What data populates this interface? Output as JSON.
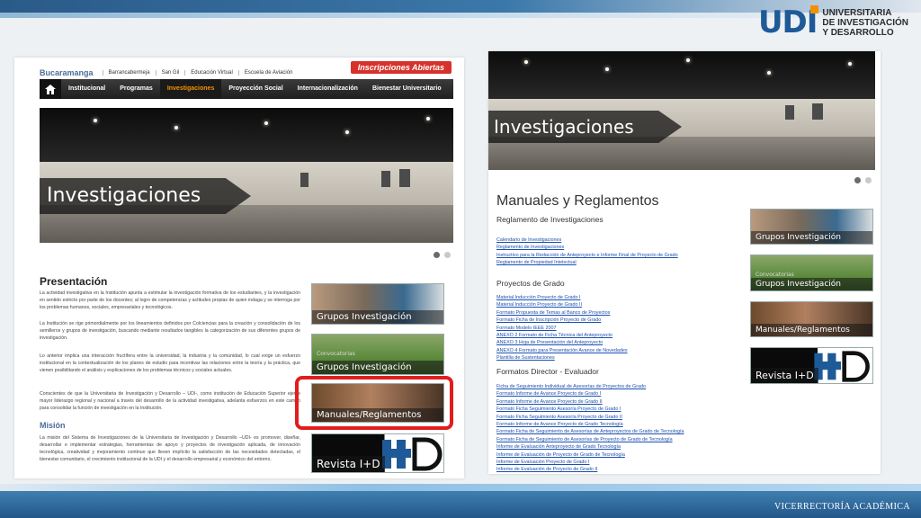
{
  "slide": {
    "logo": {
      "mark": "UDI",
      "line1": "UNIVERSITARIA",
      "line2": "DE INVESTIGACIÓN",
      "line3": "Y DESARROLLO"
    },
    "footer": "VICERRECTORÍA ACADÉMICA",
    "colors": {
      "brand_blue": "#1f5a98",
      "accent_orange": "#f29100",
      "highlight_red": "#e21d1d"
    }
  },
  "left": {
    "campus_main": "Bucaramanga",
    "campus_links": [
      "Barrancabermeja",
      "San Gil",
      "Educación Virtual",
      "Escuela de Aviación"
    ],
    "inscripciones": "Inscripciones Abiertas",
    "nav": {
      "home_icon": "home-icon",
      "items": [
        "Institucional",
        "Programas",
        "Investigaciones",
        "Proyección Social",
        "Internacionalización",
        "Bienestar Universitario"
      ],
      "active": "Investigaciones"
    },
    "banner_label": "Investigaciones",
    "presentacion_title": "Presentación",
    "paragraphs": [
      "La actividad investigativa en la Institución apunta a estimular la investigación formativa de los estudiantes, y la investigación en sentido estricto por parte de los docentes; al logro de competencias y actitudes propias de quien indaga y se interroga por los problemas humanos, sociales, empresariales y tecnológicos.",
      "La Institución se rige primordialmente por los lineamientos definidos por Colciencias para la creación y consolidación de los semilleros y grupos de investigación, buscando mediante resultados tangibles la categorización de sus diferentes grupos de investigación.",
      "Lo anterior implica una interacción fructífera entre la universidad, la industria y la comunidad, lo cual exige un esfuerzo institucional en la contextualización de los planes de estudio para incentivar las relaciones entre la teoría y la práctica, que vienen posibilitando el análisis y explicaciones de los problemas técnicos y sociales actuales.",
      "Conscientes de que la Universitaria de Investigación y Desarrollo – UDI-, como institución de Educación Superior ejerce mayor liderazgo regional y nacional a través del desarrollo de la actividad investigativa, adelanta esfuerzos en este campo para consolidar la función de investigación en la Institución."
    ],
    "mision_title": "Misión",
    "mision_text": "La misión del Sistema de Investigaciones de la Universitaria de Investigación y Desarrollo –UDI- es promover, diseñar, desarrollar e implementar estrategias, herramientas de apoyo y proyectos de investigación aplicada, de innovación tecnológica, creatividad y mejoramiento continuo que lleven implícito la satisfacción de las necesidades detectadas, el bienestar comunitario, el crecimiento institucional de la UDI y el desarrollo empresarial y económico del entorno.",
    "tiles": {
      "grupos": "Grupos Investigación",
      "convocatorias_pre": "Convocatorias",
      "convocatorias": "Grupos Investigación",
      "manuales": "Manuales/Reglamentos",
      "revista": "Revista I+D"
    }
  },
  "right": {
    "banner_label": "Investigaciones",
    "title": "Manuales y Reglamentos",
    "sections": [
      {
        "heading": "Reglamento de Investigaciones",
        "links": [
          "Calendario de Investigaciones",
          "Reglamento de Investigaciones",
          "Instructivo para la Redacción de Anteproyecto e Informe Final de Proyecto de Grado",
          "Reglamento de Propiedad Intelectual"
        ]
      },
      {
        "heading": "Proyectos de Grado",
        "links": [
          "Material Inducción Proyecto de Grado I",
          "Material Inducción Proyecto de Grado II",
          "Formato Propuesta de Temas al Banco de Proyectos",
          "Formato Ficha de Inscripción Proyecto de Grado",
          "Formato Modelo IEEE 2007",
          "ANEXO 2 Formato de Ficha Técnica del Anteproyecto",
          "ANEXO 3 Hoja de Presentación del Anteproyecto",
          "ANEXO 4 Formato para Presentación Avance de Novedades",
          "Plantilla de Sustentaciones"
        ]
      },
      {
        "heading": "Formatos Director - Evaluador",
        "links": [
          "Ficha de Seguimiento Individual de Asesorías de Proyectos de Grado",
          "Formato Informe de Avance Proyecto de Grado I",
          "Formato Informe de Avance Proyecto de Grado II",
          "Formato Ficha Seguimiento Asesoría Proyecto de Grado I",
          "Formato Ficha Seguimiento Asesoría Proyecto de Grado II",
          "Formato Informe de Avance Proyecto de Grado Tecnología",
          "Formato Ficha de Seguimiento de Asesorías de Anteproyectos de Grado de Tecnología",
          "Formato Ficha de Seguimiento de Asesorías de Proyecto de Grado de Tecnología",
          "Informe de Evaluación Anteproyecto de Grado Tecnología",
          "Informe de Evaluación de Proyecto de Grado de Tecnología",
          "Informe de Evaluación Proyecto de Grado I",
          "Informe de Evaluación de Proyecto de Grado II"
        ]
      }
    ],
    "tiles": {
      "grupos": "Grupos Investigación",
      "convocatorias_pre": "Convocatorias",
      "convocatorias": "Grupos Investigación",
      "manuales": "Manuales/Reglamentos",
      "revista": "Revista I+D"
    }
  }
}
